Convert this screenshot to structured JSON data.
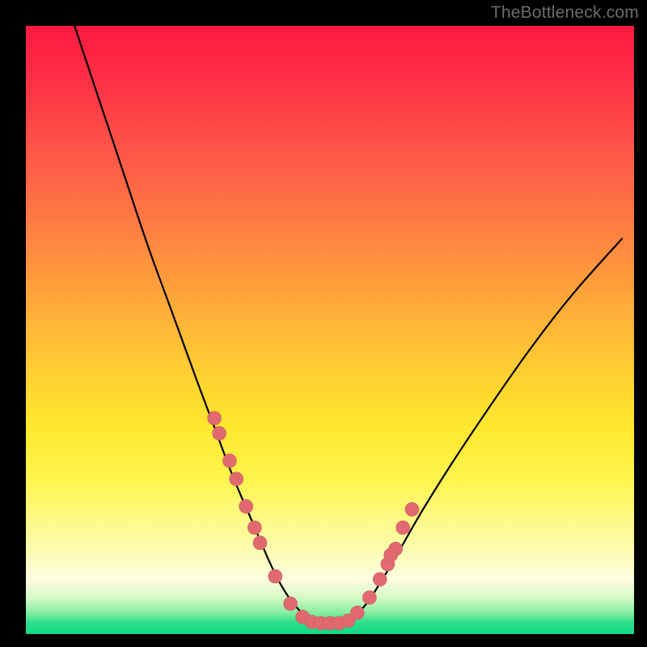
{
  "watermark": "TheBottleneck.com",
  "colors": {
    "dot_fill": "#e06a6f",
    "dot_stroke": "#c95b60",
    "curve": "#000000"
  },
  "chart_data": {
    "type": "line",
    "title": "",
    "xlabel": "",
    "ylabel": "",
    "xlim": [
      0,
      100
    ],
    "ylim": [
      0,
      100
    ],
    "grid": false,
    "legend": false,
    "series": [
      {
        "name": "bottleneck-curve",
        "x": [
          8,
          12,
          16,
          20,
          24,
          28,
          31,
          34,
          37,
          40,
          42,
          44,
          46,
          48,
          50,
          52,
          54,
          56,
          58,
          61,
          65,
          70,
          76,
          83,
          90,
          98
        ],
        "y": [
          100,
          88,
          76,
          64,
          53,
          42,
          34,
          26,
          19,
          12,
          8,
          5,
          3,
          2,
          2,
          2,
          3,
          5,
          8,
          13,
          20,
          28,
          37,
          47,
          56,
          65
        ]
      }
    ],
    "dots": {
      "name": "samples",
      "x": [
        31.0,
        31.8,
        33.5,
        34.6,
        36.2,
        37.6,
        38.5,
        41.0,
        43.5,
        45.5,
        47.0,
        48.5,
        50.0,
        51.5,
        53.0,
        54.5,
        56.5,
        58.2,
        59.5,
        60.8,
        62.0,
        60.0,
        63.5
      ],
      "y": [
        35.5,
        33.0,
        28.5,
        25.5,
        21.0,
        17.5,
        15.0,
        9.5,
        5.0,
        2.8,
        2.0,
        1.8,
        1.8,
        1.8,
        2.2,
        3.5,
        6.0,
        9.0,
        11.5,
        14.0,
        17.5,
        13.0,
        20.5
      ],
      "r": 8.5
    }
  }
}
